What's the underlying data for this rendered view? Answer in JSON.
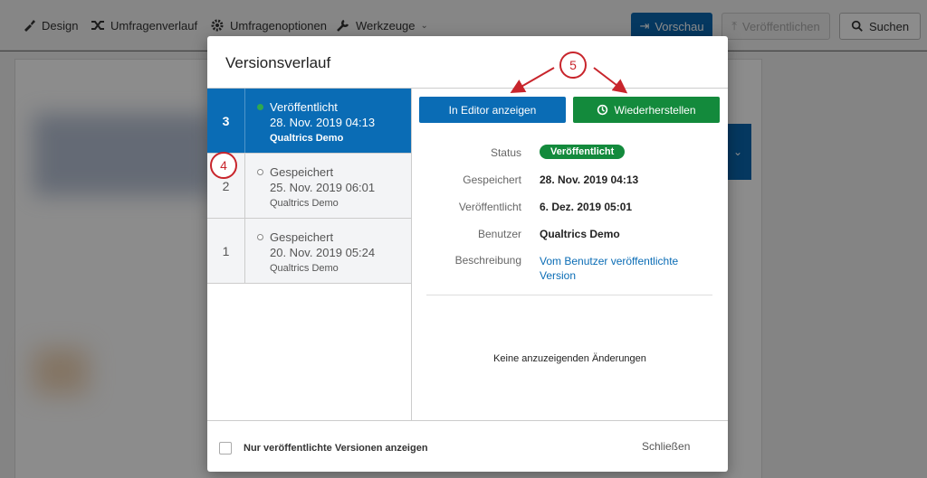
{
  "toolbar": {
    "design": "Design",
    "history": "Umfragenverlauf",
    "options": "Umfragenoptionen",
    "tools": "Werkzeuge",
    "preview": "Vorschau",
    "publish": "Veröffentlichen",
    "search": "Suchen"
  },
  "modal": {
    "title": "Versionsverlauf",
    "versions": [
      {
        "number": "3",
        "status": "Veröffentlicht",
        "date": "28. Nov. 2019 04:13",
        "user": "Qualtrics Demo"
      },
      {
        "number": "2",
        "status": "Gespeichert",
        "date": "25. Nov. 2019 06:01",
        "user": "Qualtrics Demo"
      },
      {
        "number": "1",
        "status": "Gespeichert",
        "date": "20. Nov. 2019 05:24",
        "user": "Qualtrics Demo"
      }
    ],
    "buttons": {
      "editor": "In Editor anzeigen",
      "restore": "Wiederherstellen"
    },
    "details": {
      "status_label": "Status",
      "status_value": "Veröffentlicht",
      "saved_label": "Gespeichert",
      "saved_value": "28. Nov. 2019 04:13",
      "published_label": "Veröffentlicht",
      "published_value": "6. Dez. 2019 05:01",
      "user_label": "Benutzer",
      "user_value": "Qualtrics Demo",
      "description_label": "Beschreibung",
      "description_value": "Vom Benutzer veröffentlichte Version"
    },
    "no_changes": "Keine anzuzeigenden Änderungen",
    "footer": {
      "checkbox_label": "Nur veröffentlichte Versionen anzeigen",
      "close": "Schließen"
    }
  },
  "annotations": {
    "marker_4": "4",
    "marker_5": "5"
  },
  "colors": {
    "accent_blue": "#0a6cb5",
    "restore_green": "#138a3c",
    "annotation_red": "#c8252c"
  }
}
